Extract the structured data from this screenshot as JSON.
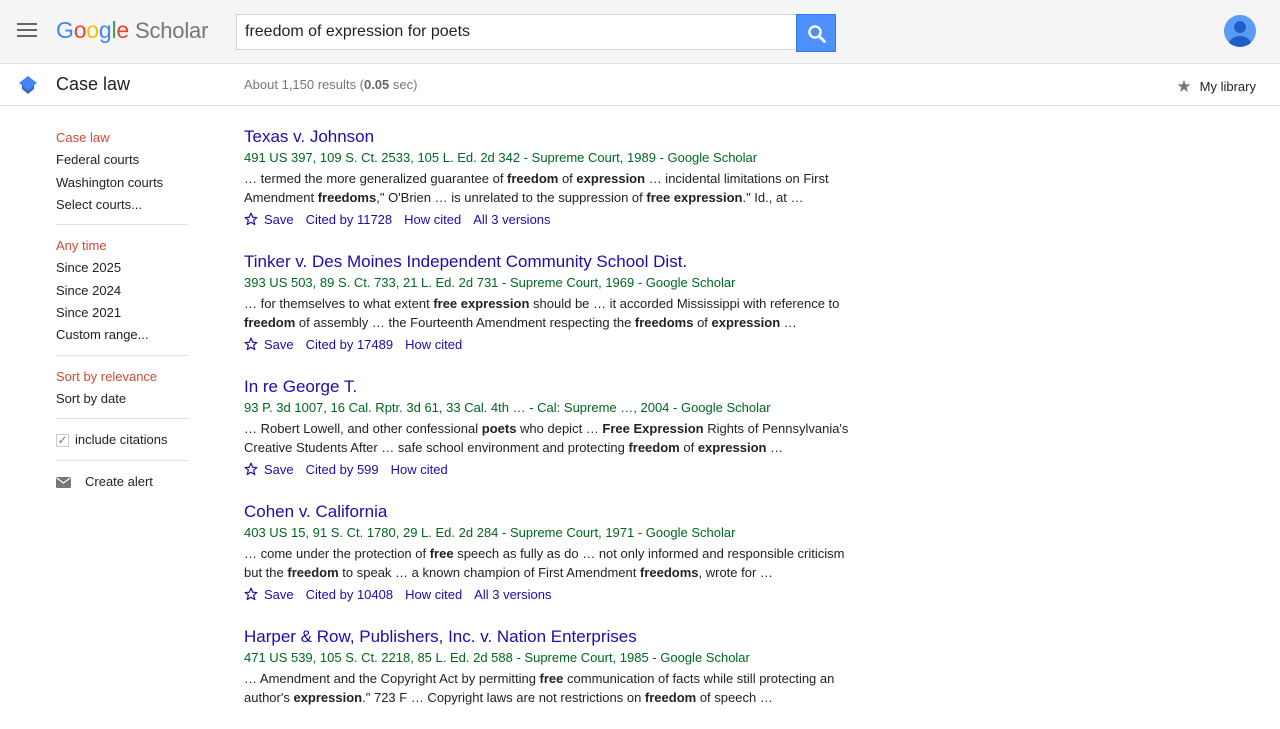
{
  "header": {
    "logo_letters": [
      {
        "ch": "G",
        "color": "#4285f4"
      },
      {
        "ch": "o",
        "color": "#ea4335"
      },
      {
        "ch": "o",
        "color": "#fbbc05"
      },
      {
        "ch": "g",
        "color": "#4285f4"
      },
      {
        "ch": "l",
        "color": "#34a853"
      },
      {
        "ch": "e",
        "color": "#ea4335"
      }
    ],
    "logo_suffix": "Scholar",
    "search_value": "freedom of expression for poets",
    "accent_color": "#4d90fe"
  },
  "subheader": {
    "section_title": "Case law",
    "stats_prefix": "About 1,150 results (",
    "stats_time": "0.05",
    "stats_suffix": " sec)",
    "my_library": "My library"
  },
  "sidebar": {
    "courts": [
      "Case law",
      "Federal courts",
      "Washington courts",
      "Select courts..."
    ],
    "times": [
      "Any time",
      "Since 2025",
      "Since 2024",
      "Since 2021",
      "Custom range..."
    ],
    "sorts": [
      "Sort by relevance",
      "Sort by date"
    ],
    "include_citations": "include citations",
    "create_alert": "Create alert"
  },
  "results": [
    {
      "title": "Texas v. Johnson",
      "cite": "491 US 397, 109 S. Ct. 2533, 105 L. Ed. 2d 342 - Supreme Court, 1989 - Google Scholar",
      "snippet": [
        [
          "… termed the more generalized guarantee of ",
          false
        ],
        [
          "freedom",
          true
        ],
        [
          " of ",
          false
        ],
        [
          "expression",
          true
        ],
        [
          " … incidental limitations on First Amendment ",
          false
        ],
        [
          "freedoms",
          true
        ],
        [
          ",\" O'Brien … is unrelated to the suppression of ",
          false
        ],
        [
          "free expression",
          true
        ],
        [
          ".\" Id., at …",
          false
        ]
      ],
      "save": "Save",
      "cited_by": "Cited by 11728",
      "how_cited": "How cited",
      "versions": "All 3 versions"
    },
    {
      "title": "Tinker v. Des Moines Independent Community School Dist.",
      "cite": "393 US 503, 89 S. Ct. 733, 21 L. Ed. 2d 731 - Supreme Court, 1969 - Google Scholar",
      "snippet": [
        [
          "… for themselves to what extent ",
          false
        ],
        [
          "free expression",
          true
        ],
        [
          " should be … it accorded Mississippi with reference to ",
          false
        ],
        [
          "freedom",
          true
        ],
        [
          " of assembly … the Fourteenth Amendment respecting the ",
          false
        ],
        [
          "freedoms",
          true
        ],
        [
          " of ",
          false
        ],
        [
          "expression",
          true
        ],
        [
          " …",
          false
        ]
      ],
      "save": "Save",
      "cited_by": "Cited by 17489",
      "how_cited": "How cited",
      "versions": ""
    },
    {
      "title": "In re George T.",
      "cite": "93 P. 3d 1007, 16 Cal. Rptr. 3d 61, 33 Cal. 4th … - Cal: Supreme …, 2004 - Google Scholar",
      "snippet": [
        [
          "… Robert Lowell, and other confessional ",
          false
        ],
        [
          "poets",
          true
        ],
        [
          " who depict … ",
          false
        ],
        [
          "Free Expression",
          true
        ],
        [
          " Rights of Pennsylvania's Creative Students After … safe school environment and protecting ",
          false
        ],
        [
          "freedom",
          true
        ],
        [
          " of ",
          false
        ],
        [
          "expression",
          true
        ],
        [
          " …",
          false
        ]
      ],
      "save": "Save",
      "cited_by": "Cited by 599",
      "how_cited": "How cited",
      "versions": ""
    },
    {
      "title": "Cohen v. California",
      "cite": "403 US 15, 91 S. Ct. 1780, 29 L. Ed. 2d 284 - Supreme Court, 1971 - Google Scholar",
      "snippet": [
        [
          "… come under the protection of ",
          false
        ],
        [
          "free",
          true
        ],
        [
          " speech as fully as do … not only informed and responsible criticism but the ",
          false
        ],
        [
          "freedom",
          true
        ],
        [
          " to speak … a known champion of First Amendment ",
          false
        ],
        [
          "freedoms",
          true
        ],
        [
          ", wrote for …",
          false
        ]
      ],
      "save": "Save",
      "cited_by": "Cited by 10408",
      "how_cited": "How cited",
      "versions": "All 3 versions"
    },
    {
      "title": "Harper & Row, Publishers, Inc. v. Nation Enterprises",
      "cite": "471 US 539, 105 S. Ct. 2218, 85 L. Ed. 2d 588 - Supreme Court, 1985 - Google Scholar",
      "snippet": [
        [
          "… Amendment and the Copyright Act by permitting ",
          false
        ],
        [
          "free",
          true
        ],
        [
          " communication of facts while still protecting an author's ",
          false
        ],
        [
          "expression",
          true
        ],
        [
          ".\" 723 F … Copyright laws are not restrictions on ",
          false
        ],
        [
          "freedom",
          true
        ],
        [
          " of speech …",
          false
        ]
      ],
      "save": "",
      "cited_by": "",
      "how_cited": "",
      "versions": ""
    }
  ]
}
